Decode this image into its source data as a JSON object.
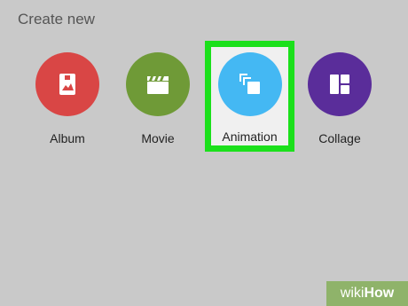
{
  "header": {
    "title": "Create new"
  },
  "options": [
    {
      "label": "Album",
      "icon": "photo-album-icon",
      "color": "#d94645",
      "selected": false
    },
    {
      "label": "Movie",
      "icon": "clapperboard-icon",
      "color": "#6f9a37",
      "selected": false
    },
    {
      "label": "Animation",
      "icon": "stacked-frames-icon",
      "color": "#44b8f3",
      "selected": true
    },
    {
      "label": "Collage",
      "icon": "collage-grid-icon",
      "color": "#5a2d9a",
      "selected": false
    }
  ],
  "highlight_color": "#1be01b",
  "watermark": {
    "part1": "wiki",
    "part2": "How"
  }
}
